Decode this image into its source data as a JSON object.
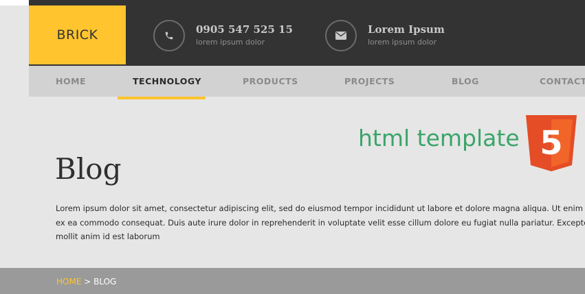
{
  "header": {
    "logo_text": "BRICK",
    "phone": {
      "number": "0905 547 525 15",
      "sub": "lorem ipsum dolor",
      "icon": "phone-icon"
    },
    "email": {
      "title": "Lorem Ipsum",
      "sub": "lorem ipsum dolor",
      "icon": "envelope-icon"
    }
  },
  "nav": {
    "items": [
      {
        "label": "HOME"
      },
      {
        "label": "TECHNOLOGY"
      },
      {
        "label": "PRODUCTS"
      },
      {
        "label": "PROJECTS"
      },
      {
        "label": "BLOG"
      },
      {
        "label": "CONTACTS"
      }
    ],
    "active": "TECHNOLOGY"
  },
  "watermark": {
    "text": "html template",
    "badge_icon": "html5-icon",
    "badge_text": "5"
  },
  "main": {
    "title": "Blog",
    "intro_lines": [
      "Lorem ipsum dolor sit amet, consectetur adipiscing elit, sed do eiusmod tempor incididunt ut labore et dolore magna aliqua. Ut enim",
      "ex ea commodo consequat. Duis aute irure dolor in reprehenderit in voluptate velit esse cillum dolore eu fugiat nulla pariatur. Excepteur",
      "mollit anim id est laborum"
    ]
  },
  "breadcrumb": {
    "home": "HOME",
    "separator": " > ",
    "current": "BLOG"
  },
  "colors": {
    "accent": "#ffc42e",
    "topbar": "#333333",
    "nav": "#d2d2d2",
    "watermark": "#3aa56a",
    "html5": "#e44d26"
  }
}
